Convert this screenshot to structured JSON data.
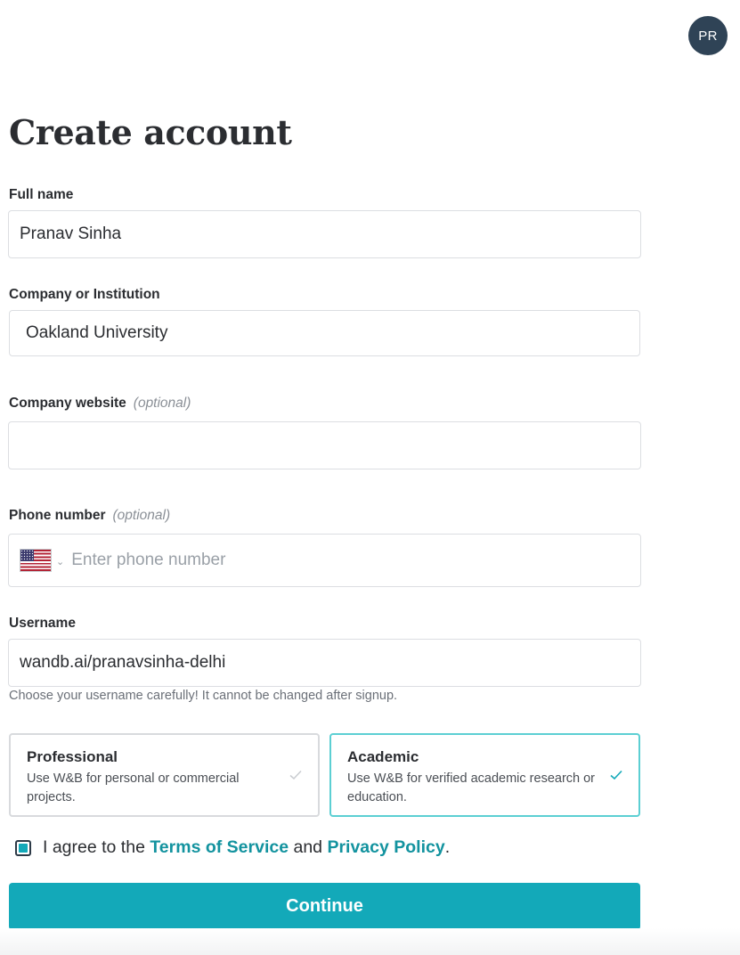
{
  "header": {
    "avatar_initials": "PR"
  },
  "page_title": "Create account",
  "form": {
    "full_name": {
      "label": "Full name",
      "value": "Pranav Sinha"
    },
    "company": {
      "label": "Company or Institution",
      "value": "Oakland University"
    },
    "website": {
      "label": "Company website",
      "optional": "(optional)",
      "value": "",
      "placeholder": ""
    },
    "phone": {
      "label": "Phone number",
      "optional": "(optional)",
      "value": "",
      "placeholder": "Enter phone number",
      "country_icon": "us-flag-icon"
    },
    "username": {
      "label": "Username",
      "value": "wandb.ai/pranavsinha-delhi",
      "help": "Choose your username carefully! It cannot be changed after signup."
    }
  },
  "account_types": [
    {
      "title": "Professional",
      "description": "Use W&B for personal or commercial projects.",
      "selected": false
    },
    {
      "title": "Academic",
      "description": "Use W&B for verified academic research or education.",
      "selected": true
    }
  ],
  "agreement": {
    "checked": true,
    "prefix": "I agree to the",
    "terms_link": "Terms of Service",
    "middle": "and",
    "privacy_link": "Privacy Policy",
    "suffix": "."
  },
  "continue_label": "Continue",
  "colors": {
    "accent": "#13a9b9",
    "link": "#13939f",
    "selected_border": "#5ccfd3",
    "avatar_bg": "#2f4356"
  }
}
